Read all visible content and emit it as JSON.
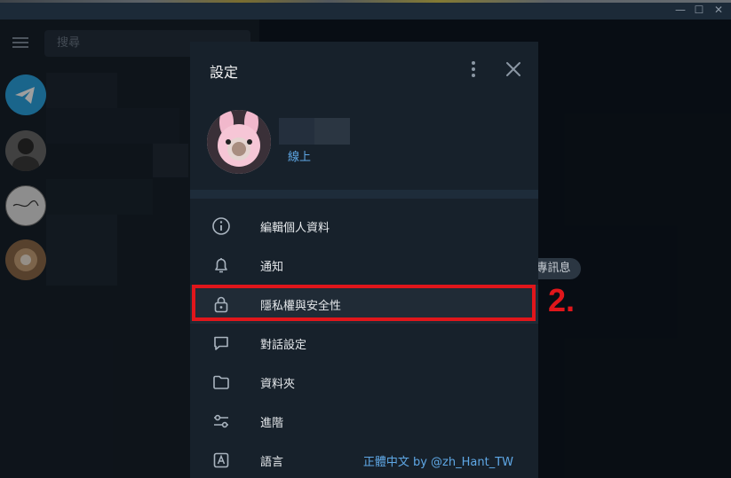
{
  "window": {
    "minimize_glyph": "—",
    "maximize_glyph": "☐",
    "close_glyph": "✕"
  },
  "sidebar": {
    "search_placeholder": "搜尋"
  },
  "background": {
    "message_pill": "專訊息"
  },
  "settings_modal": {
    "title": "設定",
    "profile_status": "線上",
    "menu_items": [
      {
        "label": "編輯個人資料",
        "icon": "info-icon"
      },
      {
        "label": "通知",
        "icon": "bell-icon"
      },
      {
        "label": "隱私權與安全性",
        "icon": "lock-icon"
      },
      {
        "label": "對話設定",
        "icon": "chat-bubble-icon"
      },
      {
        "label": "資料夾",
        "icon": "folder-icon"
      },
      {
        "label": "進階",
        "icon": "sliders-icon"
      },
      {
        "label": "語言",
        "icon": "language-icon",
        "value": "正體中文 by @zh_Hant_TW"
      }
    ]
  },
  "annotation": {
    "step": "2."
  },
  "colors": {
    "accent": "#5fa8e6",
    "highlight_red": "#e0161b",
    "modal_bg": "#17212b"
  }
}
